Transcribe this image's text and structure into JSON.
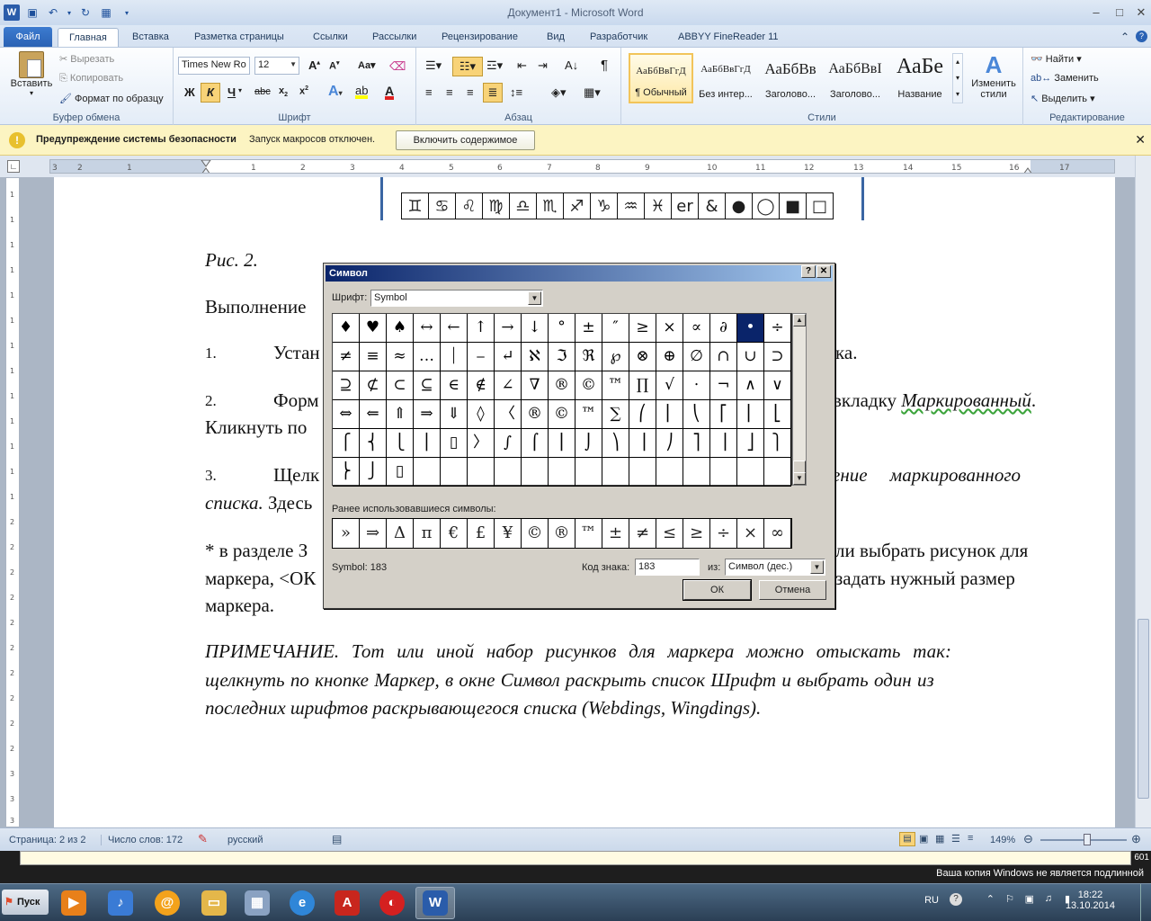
{
  "title": {
    "text": "Документ1  -  Microsoft Word"
  },
  "tabs": [
    "Файл",
    "Главная",
    "Вставка",
    "Разметка страницы",
    "Ссылки",
    "Рассылки",
    "Рецензирование",
    "Вид",
    "Разработчик",
    "ABBYY FineReader 11"
  ],
  "ribbon": {
    "clipboard": {
      "paste": "Вставить",
      "cut": "Вырезать",
      "copy": "Копировать",
      "format_painter": "Формат по образцу",
      "label": "Буфер обмена"
    },
    "font": {
      "family": "Times New Ro",
      "size": "12",
      "label": "Шрифт"
    },
    "paragraph": {
      "label": "Абзац"
    },
    "styles": {
      "items": [
        {
          "preview": "АаБбВвГгД",
          "name": "¶ Обычный"
        },
        {
          "preview": "АаБбВвГгД",
          "name": "Без интер..."
        },
        {
          "preview": "АаБбВв",
          "name": "Заголово..."
        },
        {
          "preview": "АаБбВвІ",
          "name": "Заголово..."
        },
        {
          "preview": "АаБе",
          "name": "Название"
        }
      ],
      "change": "Изменить стили",
      "label": "Стили"
    },
    "editing": {
      "find": "Найти",
      "replace": "Заменить",
      "select": "Выделить",
      "label": "Редактирование"
    }
  },
  "security": {
    "title": "Предупреждение системы безопасности",
    "message": "Запуск макросов отключен.",
    "button": "Включить содержимое"
  },
  "document": {
    "caption": "Рис. 2.",
    "p_exec": "Выполнение",
    "item1_num": "1.",
    "item1_a": "Устан",
    "item1_b": "ка.",
    "item2_num": "2.",
    "item2_a": "Форм",
    "item2_b": "вкладку ",
    "item2_c": "Маркированный",
    "item2_line2": "Кликнуть по",
    "item3_num": "3.",
    "item3_a": "Щелк",
    "item3_b": "ение маркированного",
    "item3_c": "списка.",
    "item3_d": " Здесь",
    "star_a": "* в разделе З",
    "star_b": "ли выбрать рисунок для",
    "star_c": "маркера, <ОК",
    "star_d": "задать нужный размер",
    "star_e": "маркера.",
    "note1": "ПРИМЕЧАНИЕ. Тот или иной набор рисунков для маркера можно отыскать так:",
    "note2": "щелкнуть по кнопке Маркер, в окне Символ раскрыть список Шрифт и выбрать один из",
    "note3": "последних шрифтов раскрывающегося списка (Webdings, Wingdings).",
    "figure_symbols": [
      "♊",
      "♋",
      "♌",
      "♍",
      "♎",
      "♏",
      "♐",
      "♑",
      "♒",
      "♓",
      "er",
      "&",
      "●",
      "◯",
      "■",
      "□"
    ]
  },
  "dialog": {
    "title": "Символ",
    "font_label": "Шрифт:",
    "font_value": "Symbol",
    "grid": [
      [
        "♦",
        "♥",
        "♠",
        "↔",
        "←",
        "↑",
        "→",
        "↓",
        "°",
        "±",
        "″",
        "≥",
        "×",
        "∝",
        "∂",
        "•",
        "÷"
      ],
      [
        "≠",
        "≡",
        "≈",
        "…",
        "⏐",
        "⎯",
        "↵",
        "ℵ",
        "ℑ",
        "ℜ",
        "℘",
        "⊗",
        "⊕",
        "∅",
        "∩",
        "∪",
        "⊃"
      ],
      [
        "⊇",
        "⊄",
        "⊂",
        "⊆",
        "∈",
        "∉",
        "∠",
        "∇",
        "®",
        "©",
        "™",
        "∏",
        "√",
        "⋅",
        "¬",
        "∧",
        "∨"
      ],
      [
        "⇔",
        "⇐",
        "⇑",
        "⇒",
        "⇓",
        "◊",
        "〈",
        "®",
        "©",
        "™",
        "∑",
        "⎛",
        "⎜",
        "⎝",
        "⎡",
        "⎢",
        "⎣"
      ],
      [
        "⎧",
        "⎨",
        "⎩",
        "⎪",
        "▯",
        "〉",
        "∫",
        "⌠",
        "⎮",
        "⌡",
        "⎞",
        "⎟",
        "⎠",
        "⎤",
        "⎥",
        "⎦",
        "⎫"
      ],
      [
        "⎬",
        "⎭",
        "▯",
        "",
        "",
        "",
        "",
        "",
        "",
        "",
        "",
        "",
        "",
        "",
        "",
        "",
        ""
      ]
    ],
    "selected_symbol": "•",
    "recent_label": "Ранее использовавшиеся символы:",
    "recent": [
      "»",
      "⇒",
      "Δ",
      "π",
      "€",
      "£",
      "¥",
      "©",
      "®",
      "™",
      "±",
      "≠",
      "≤",
      "≥",
      "÷",
      "×",
      "∞"
    ],
    "symbol_name": "Symbol: 183",
    "code_label": "Код знака:",
    "code_value": "183",
    "from_label": "из:",
    "from_value": "Символ (дес.)",
    "ok": "ОК",
    "cancel": "Отмена"
  },
  "status": {
    "page": "Страница: 2 из 2",
    "words": "Число слов: 172",
    "lang": "русский",
    "zoom": "149%"
  },
  "watermark": {
    "text": "Ваша копия Windows не является подлинной",
    "number": "601"
  },
  "taskbar": {
    "start": "Пуск",
    "lang": "RU",
    "time": "18:22",
    "date": "13.10.2014"
  }
}
